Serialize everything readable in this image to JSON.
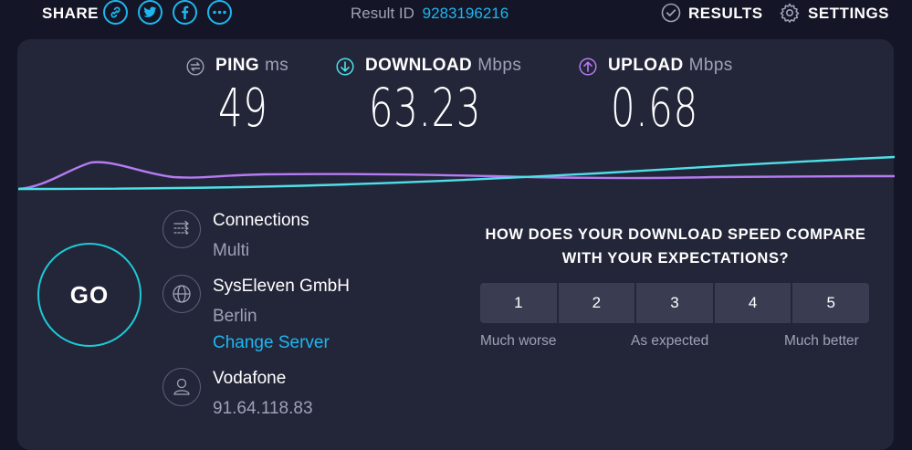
{
  "topbar": {
    "share_label": "SHARE",
    "share_icons": [
      "link-icon",
      "twitter-icon",
      "facebook-icon",
      "more-icon"
    ],
    "result_label": "Result ID",
    "result_id": "9283196216",
    "results_label": "RESULTS",
    "settings_label": "SETTINGS"
  },
  "metrics": {
    "ping": {
      "label": "PING",
      "unit": "ms",
      "value": "49",
      "icon": "ping-icon"
    },
    "download": {
      "label": "DOWNLOAD",
      "unit": "Mbps",
      "value": "63.23",
      "icon": "download-arrow-icon"
    },
    "upload": {
      "label": "UPLOAD",
      "unit": "Mbps",
      "value": "0.68",
      "icon": "upload-arrow-icon"
    }
  },
  "go_label": "GO",
  "info": {
    "connections": {
      "title": "Connections",
      "value": "Multi",
      "icon": "connections-icon"
    },
    "server": {
      "title": "SysEleven GmbH",
      "location": "Berlin",
      "change_label": "Change Server",
      "icon": "globe-icon"
    },
    "provider": {
      "title": "Vodafone",
      "ip": "91.64.118.83",
      "icon": "user-icon"
    }
  },
  "survey": {
    "question_line1": "HOW DOES YOUR DOWNLOAD SPEED COMPARE",
    "question_line2": "WITH YOUR EXPECTATIONS?",
    "options": [
      "1",
      "2",
      "3",
      "4",
      "5"
    ],
    "label_low": "Much worse",
    "label_mid": "As expected",
    "label_high": "Much better"
  },
  "colors": {
    "accent_blue": "#1db7f0",
    "download_cyan": "#4ee0e6",
    "upload_purple": "#b57bf0",
    "panel": "#232639",
    "background": "#141526"
  }
}
